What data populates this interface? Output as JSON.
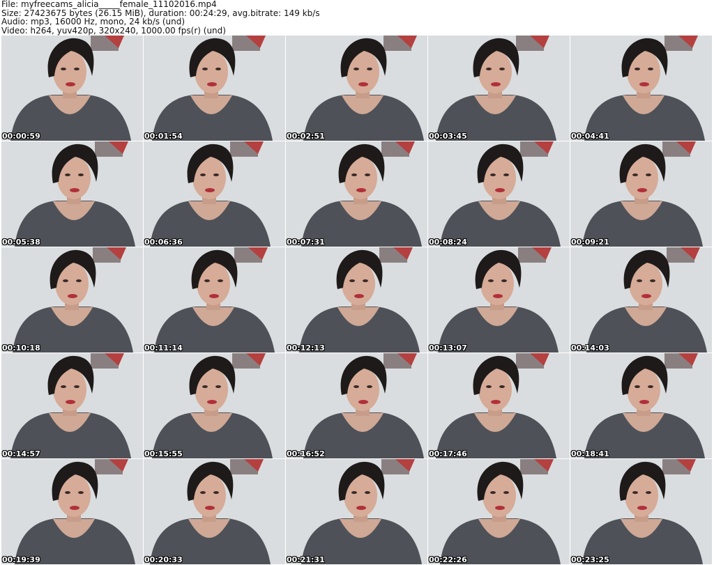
{
  "header": {
    "file": "File: myfreecams_alicia_____female_11102016.mp4",
    "size": "Size: 27423675 bytes (26.15 MiB), duration: 00:24:29, avg.bitrate: 149 kb/s",
    "audio": "Audio: mp3, 16000 Hz, mono, 24 kb/s (und)",
    "video": "Video: h264, yuv420p, 320x240, 1000.00 fps(r) (und)"
  },
  "thumbnails": [
    {
      "time": "00:00:59"
    },
    {
      "time": "00:01:54"
    },
    {
      "time": "00:02:51"
    },
    {
      "time": "00:03:45"
    },
    {
      "time": "00:04:41"
    },
    {
      "time": "00:05:38"
    },
    {
      "time": "00:06:36"
    },
    {
      "time": "00:07:31"
    },
    {
      "time": "00:08:24"
    },
    {
      "time": "00:09:21"
    },
    {
      "time": "00:10:18"
    },
    {
      "time": "00:11:14"
    },
    {
      "time": "00:12:13"
    },
    {
      "time": "00:13:07"
    },
    {
      "time": "00:14:03"
    },
    {
      "time": "00:14:57"
    },
    {
      "time": "00:15:55"
    },
    {
      "time": "00:16:52"
    },
    {
      "time": "00:17:46"
    },
    {
      "time": "00:18:41"
    },
    {
      "time": "00:19:39"
    },
    {
      "time": "00:20:33"
    },
    {
      "time": "00:21:31"
    },
    {
      "time": "00:22:26"
    },
    {
      "time": "00:23:25"
    }
  ]
}
